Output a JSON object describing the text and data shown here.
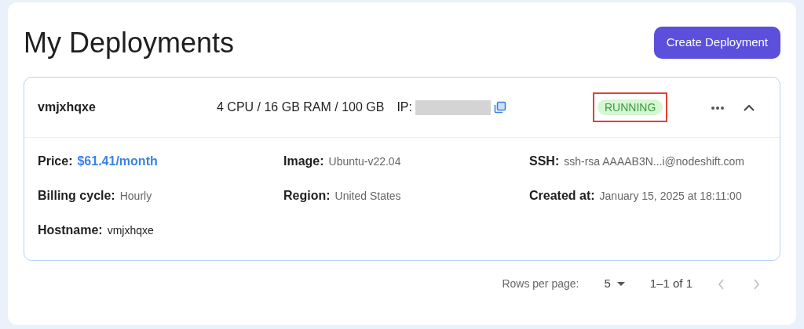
{
  "title": "My Deployments",
  "create_button": "Create Deployment",
  "deployment": {
    "name": "vmjxhqxe",
    "specs": "4 CPU / 16 GB RAM / 100 GB",
    "ip_label": "IP:",
    "ip_redacted": true,
    "status": "RUNNING",
    "status_highlighted": true,
    "expanded": true,
    "details": [
      {
        "label": "Price:",
        "value": "$61.41/month",
        "kind": "link"
      },
      {
        "label": "Image:",
        "value": "Ubuntu-v22.04",
        "kind": "text"
      },
      {
        "label": "SSH:",
        "value": "ssh-rsa AAAAB3N...i@nodeshift.com",
        "kind": "text"
      },
      {
        "label": "Billing cycle:",
        "value": "Hourly",
        "kind": "text"
      },
      {
        "label": "Region:",
        "value": "United States",
        "kind": "text"
      },
      {
        "label": "Created at:",
        "value": "January 15, 2025 at 18:11:00",
        "kind": "text"
      },
      {
        "label": "Hostname:",
        "value": "vmjxhqxe",
        "kind": "host"
      }
    ]
  },
  "pagination": {
    "rows_label": "Rows per page:",
    "rows_value": "5",
    "range": "1–1 of 1",
    "prev_disabled": true,
    "next_disabled": true
  }
}
